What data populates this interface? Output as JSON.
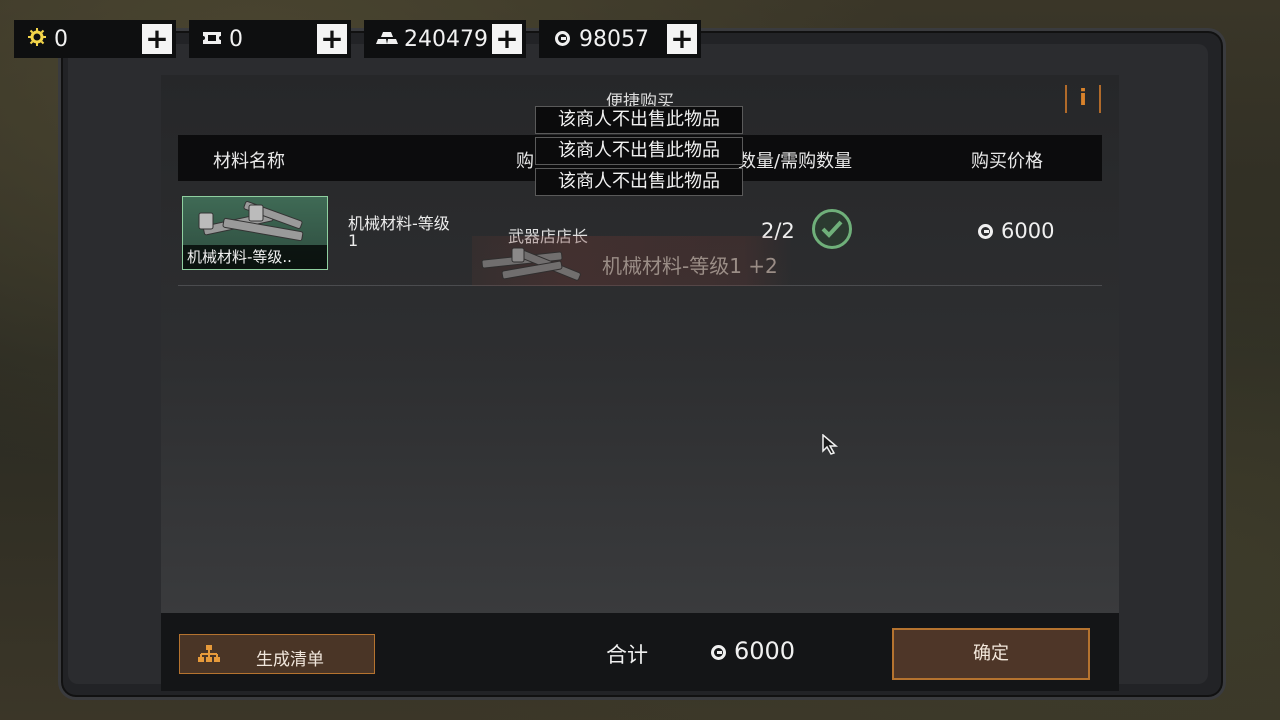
{
  "currencies": [
    {
      "icon": "gear-coin-icon",
      "value": "0"
    },
    {
      "icon": "ticket-icon",
      "value": "0"
    },
    {
      "icon": "gold-bars-icon",
      "value": "240479"
    },
    {
      "icon": "credit-coin-icon",
      "value": "98057"
    }
  ],
  "panel": {
    "title": "便捷购买",
    "info_label": "i"
  },
  "table": {
    "headers": {
      "name": "材料名称",
      "seller": "购",
      "qty": "数量/需购数量",
      "price": "购买价格"
    },
    "rows": [
      {
        "thumb_caption": "机械材料-等级..",
        "name": "机械材料-等级1",
        "seller": "武器店店长",
        "qty": "2/2",
        "price": "6000"
      }
    ]
  },
  "drag_ghost": {
    "text": "机械材料-等级1 +2"
  },
  "tooltips": [
    "该商人不出售此物品",
    "该商人不出售此物品",
    "该商人不出售此物品"
  ],
  "footer": {
    "list_button": "生成清单",
    "total_label": "合计",
    "total_value": "6000",
    "confirm_button": "确定"
  },
  "colors": {
    "accent": "#b5732f",
    "check": "#6fb07a"
  }
}
